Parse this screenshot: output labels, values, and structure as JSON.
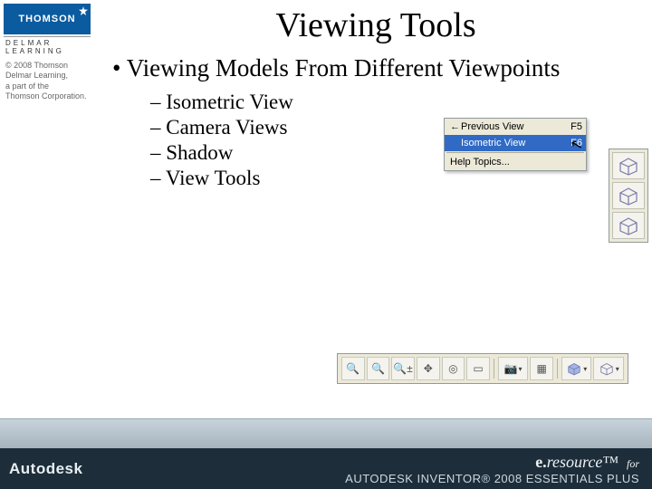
{
  "left_strip": {
    "brand_top": "THOMSON",
    "brand_sub": "DELMAR LEARNING",
    "copyright_lines": [
      "© 2008 Thomson",
      "Delmar Learning,",
      "a part of the",
      "Thomson Corporation."
    ]
  },
  "slide": {
    "title": "Viewing Tools",
    "bullet": "Viewing Models From Different Viewpoints",
    "sub_bullets": [
      "Isometric View",
      "Camera Views",
      "Shadow",
      "View Tools"
    ]
  },
  "context_menu": {
    "items": [
      {
        "label": "Previous View",
        "shortcut": "F5",
        "selected": false,
        "icon": "←"
      },
      {
        "label": "Isometric View",
        "shortcut": "F6",
        "selected": true,
        "icon": ""
      }
    ],
    "help_label": "Help Topics..."
  },
  "footer": {
    "autodesk": "Autodesk",
    "eresource_e": "e.",
    "eresource_rest": "resource",
    "eresource_tm": "™",
    "eresource_for": "for",
    "product_line": "AUTODESK INVENTOR® 2008 ESSENTIALS PLUS"
  }
}
